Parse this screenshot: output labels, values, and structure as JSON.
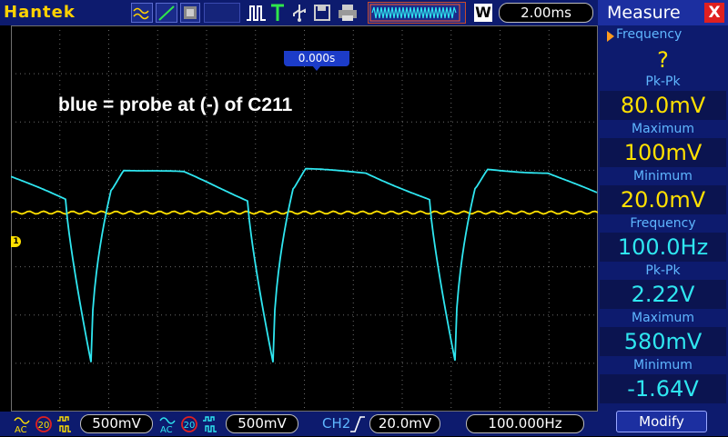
{
  "brand": "Hantek",
  "timebase": "2.00ms",
  "acquire_mode": "W",
  "trigger_position": "0.000s",
  "annotation": "blue = probe at (-) of C211",
  "colors": {
    "ch1": "#ffe000",
    "ch2": "#2fe6f0",
    "panel": "#0d1b6e",
    "accent": "#1c3cc8",
    "label": "#5fb6ff"
  },
  "icons": [
    "waveform-icon",
    "ramp-icon",
    "image-icon",
    "pulse-icon",
    "trigger-t-icon",
    "usb-icon",
    "save-icon",
    "print-icon",
    "ac-coupling-icon",
    "bandwidth-limit-icon",
    "trigger-edge-icon"
  ],
  "measure": {
    "title": "Measure",
    "close": "X",
    "selected_label": "Frequency",
    "selected_value": "?",
    "items": [
      {
        "label": "Pk-Pk",
        "value": "80.0mV"
      },
      {
        "label": "Maximum",
        "value": "100mV"
      },
      {
        "label": "Minimum",
        "value": "20.0mV"
      },
      {
        "label": "Frequency",
        "value": "100.0Hz"
      },
      {
        "label": "Pk-Pk",
        "value": "2.22V"
      },
      {
        "label": "Maximum",
        "value": "580mV"
      },
      {
        "label": "Minimum",
        "value": "-1.64V"
      }
    ],
    "modify": "Modify"
  },
  "bottom": {
    "ch1_coupling": "AC",
    "ch1_bw": "20",
    "ch1_scale": "500mV",
    "ch2_coupling": "AC",
    "ch2_bw": "20",
    "ch2_scale": "500mV",
    "trigger_source": "CH2",
    "trigger_level": "20.0mV",
    "frequency": "100.000Hz"
  },
  "markers": {
    "ch1": "1"
  }
}
